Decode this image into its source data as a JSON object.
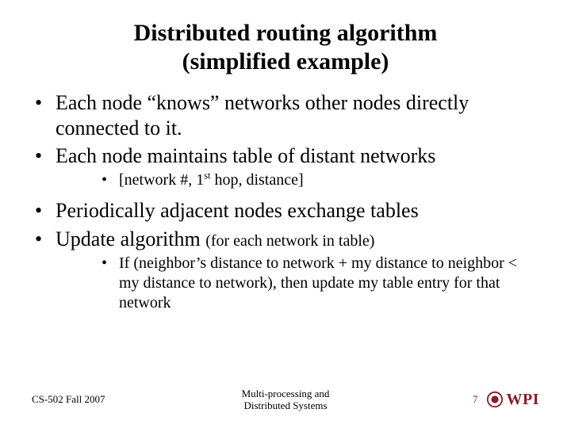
{
  "title_line1": "Distributed routing algorithm",
  "title_line2": "(simplified example)",
  "bullets": {
    "b1": "Each node “knows” networks other nodes directly connected to it.",
    "b2": "Each node maintains table of distant networks",
    "b2_sub1_pre": "[network #, 1",
    "b2_sub1_sup": "st",
    "b2_sub1_post": " hop, distance]",
    "b3": "Periodically adjacent nodes exchange tables",
    "b4_main": "Update algorithm ",
    "b4_paren": "(for each network in table)",
    "b4_sub1": "If (neighbor’s distance to network + my distance to neighbor < my distance to network), then update my table entry for that network"
  },
  "footer": {
    "left": "CS-502 Fall 2007",
    "center_l1": "Multi-processing and",
    "center_l2": "Distributed Systems",
    "page": "7",
    "logo_text": "WPI"
  }
}
